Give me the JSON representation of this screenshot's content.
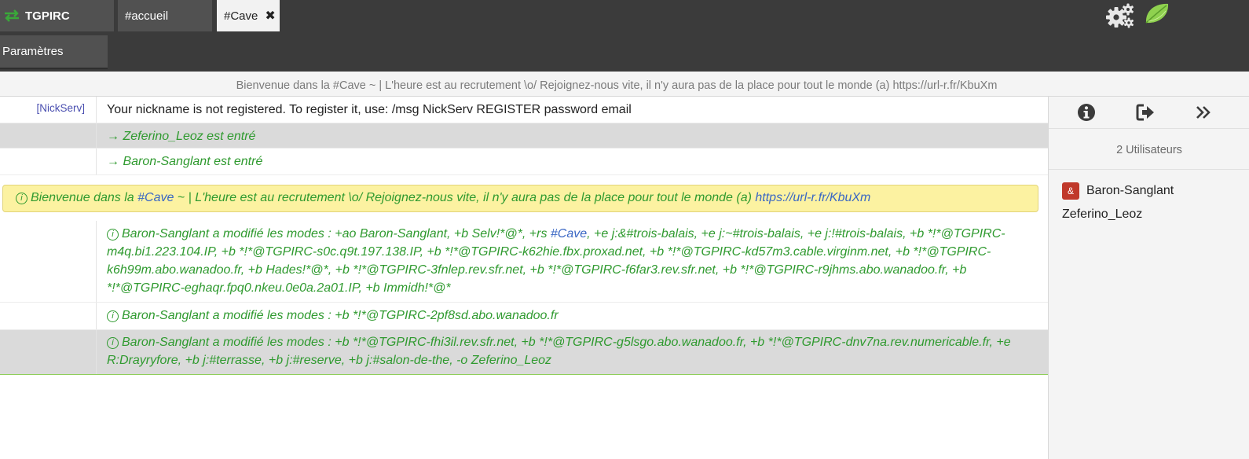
{
  "tabs": {
    "brand_label": "TGPIRC",
    "accueil_label": "#accueil",
    "cave_label": "#Cave",
    "close_symbol": "✖",
    "params_label": "Paramètres"
  },
  "topic": "Bienvenue dans la #Cave ~ | L'heure est au recrutement \\o/ Rejoignez-nous vite, il n'y aura pas de la place pour tout le monde (a) https://url-r.fr/KbuXm",
  "messages": {
    "m1_nick": "[NickServ]",
    "m1_text": "Your nickname is not registered. To register it, use: /msg NickServ REGISTER password email",
    "m2_text": "→ Zeferino_Leoz est entré",
    "m3_text": "→ Baron-Sanglant est entré",
    "m4_info": "i",
    "m4_part1": "Bienvenue dans la ",
    "m4_channel": "#Cave",
    "m4_part2": " ~ | L'heure est au recrutement \\o/ Rejoignez-nous vite, il n'y aura pas de la place pour tout le monde (a) ",
    "m4_link": "https://url-r.fr/KbuXm",
    "m5_info": "i",
    "m5_part1": "Baron-Sanglant a modifié les modes : +ao Baron-Sanglant, +b Selv!*@*, +rs ",
    "m5_channel": "#Cave",
    "m5_part2": ", +e j:&#trois-balais, +e j:~#trois-balais, +e j:!#trois-balais, +b *!*@TGPIRC-m4q.bi1.223.104.IP, +b *!*@TGPIRC-s0c.q9t.197.138.IP, +b *!*@TGPIRC-k62hie.fbx.proxad.net, +b *!*@TGPIRC-kd57m3.cable.virginm.net, +b *!*@TGPIRC-k6h99m.abo.wanadoo.fr, +b Hades!*@*, +b *!*@TGPIRC-3fnlep.rev.sfr.net, +b *!*@TGPIRC-f6far3.rev.sfr.net, +b *!*@TGPIRC-r9jhms.abo.wanadoo.fr, +b *!*@TGPIRC-eghaqr.fpq0.nkeu.0e0a.2a01.IP, +b Immidh!*@*",
    "m6_info": "i",
    "m6_text": "Baron-Sanglant a modifié les modes : +b *!*@TGPIRC-2pf8sd.abo.wanadoo.fr",
    "m7_info": "i",
    "m7_text": "Baron-Sanglant a modifié les modes : +b *!*@TGPIRC-fhi3il.rev.sfr.net, +b *!*@TGPIRC-g5lsgo.abo.wanadoo.fr, +b *!*@TGPIRC-dnv7na.rev.numericable.fr, +e R:Drayryfore, +b j:#terrasse, +b j:#reserve, +b j:#salon-de-the, -o Zeferino_Leoz"
  },
  "side": {
    "user_count": "2 Utilisateurs",
    "users": [
      {
        "badge": "&",
        "name": "Baron-Sanglant"
      },
      {
        "badge": "",
        "name": "Zeferino_Leoz"
      }
    ]
  },
  "icons": [
    "swap-icon",
    "close-icon",
    "gear-icon",
    "leaf-icon",
    "info-icon",
    "leave-icon",
    "collapse-icon"
  ],
  "colors": {
    "topbar": "#3b3b3b",
    "join_green": "#2f9a2f",
    "link_blue": "#3a67c4",
    "welcome_bg": "#fcf2a1",
    "owner_badge": "#c0392b"
  }
}
